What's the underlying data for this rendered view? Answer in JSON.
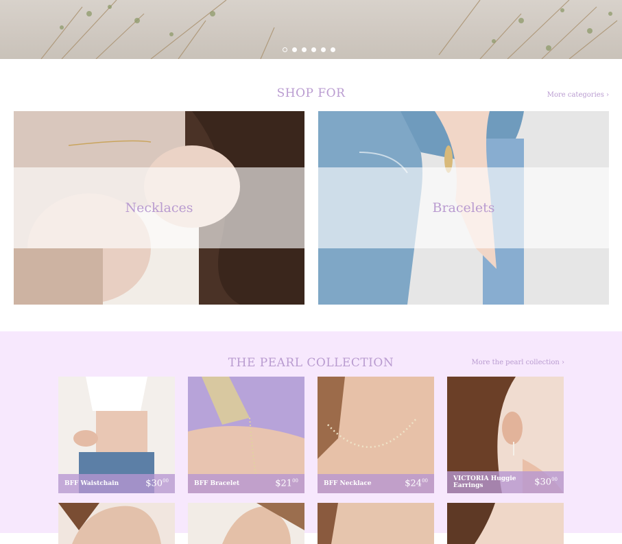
{
  "hero": {
    "slides": 6,
    "active_slide": 1
  },
  "shop_for": {
    "title": "SHOP FOR",
    "more_link": "More categories ›",
    "categories": [
      {
        "label": "Necklaces"
      },
      {
        "label": "Bracelets"
      }
    ]
  },
  "pearl_collection": {
    "title": "THE PEARL COLLECTION",
    "more_link": "More the pearl collection ›",
    "products": [
      {
        "name": "BFF Waistchain",
        "price_main": "$30",
        "price_cents": "00"
      },
      {
        "name": "BFF Bracelet",
        "price_main": "$21",
        "price_cents": "00"
      },
      {
        "name": "BFF Necklace",
        "price_main": "$24",
        "price_cents": "00"
      },
      {
        "name": "VICTORIA Huggie Earrings",
        "price_main": "$30",
        "price_cents": "00"
      }
    ]
  },
  "colors": {
    "accent": "#b99bd0",
    "pearl_bg": "#f7e8fd",
    "caption_bg": "#b696d2"
  }
}
